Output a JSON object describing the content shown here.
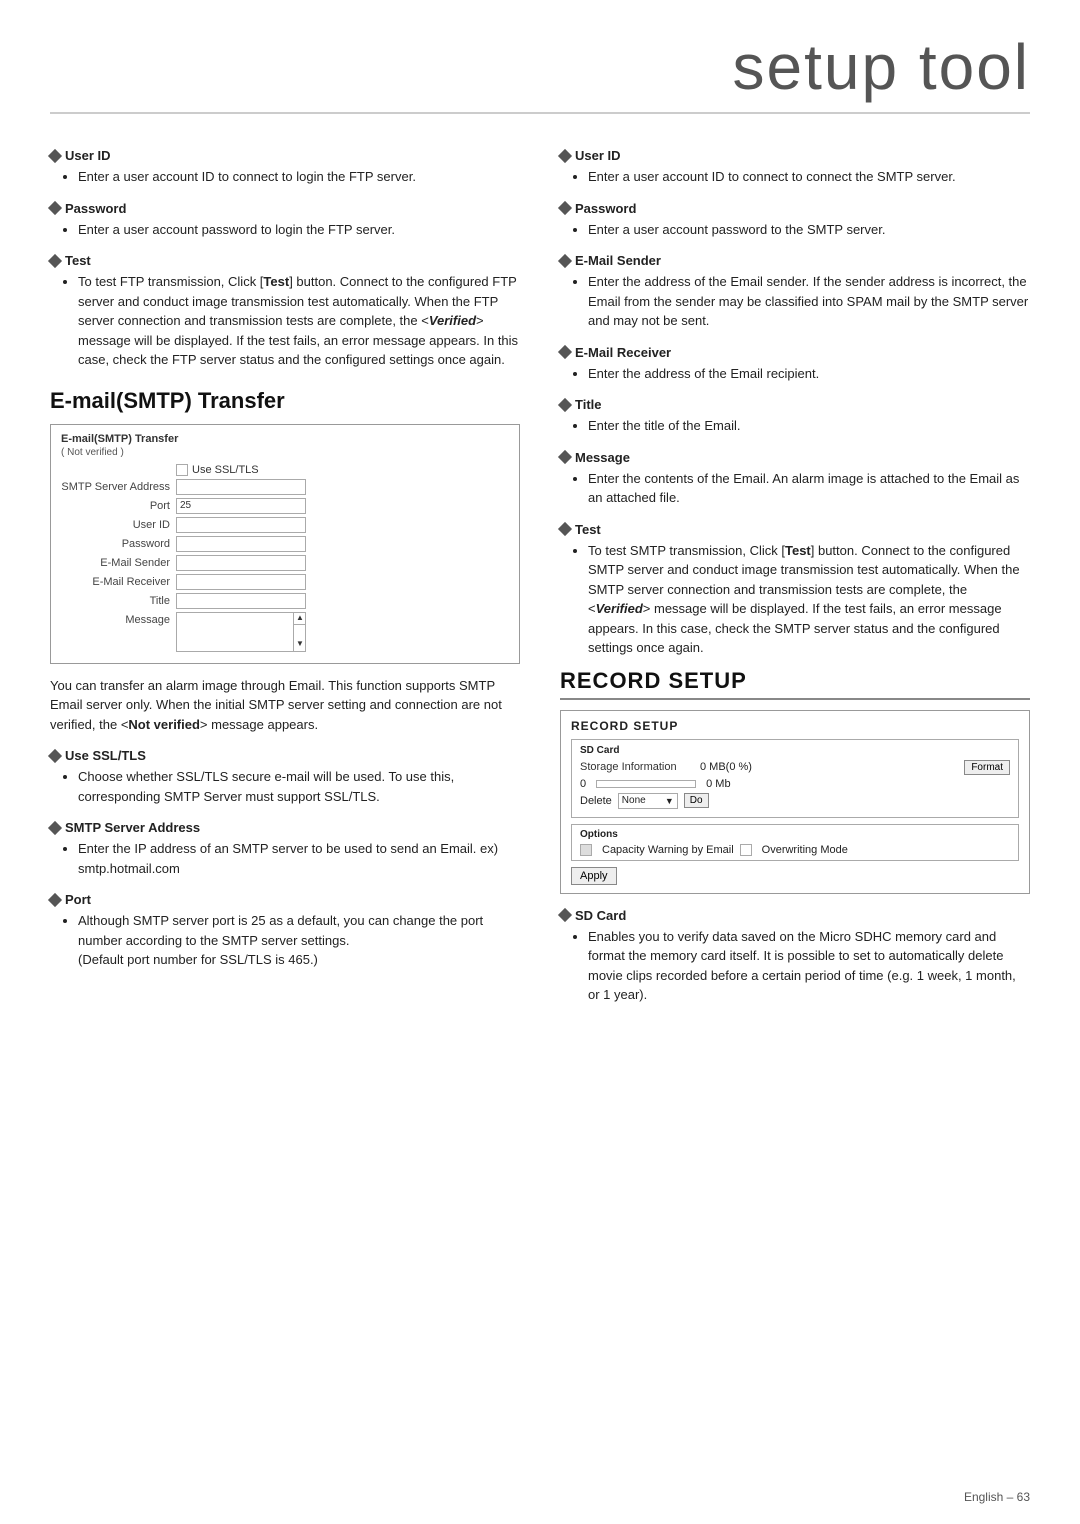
{
  "header": {
    "title": "setup tool"
  },
  "left_column": {
    "sections": [
      {
        "id": "left-user-id",
        "heading": "User ID",
        "bullets": [
          "Enter a user account ID to connect to login the FTP server."
        ]
      },
      {
        "id": "left-password",
        "heading": "Password",
        "bullets": [
          "Enter a user account password to login the FTP server."
        ]
      },
      {
        "id": "left-test",
        "heading": "Test",
        "bullets": [
          "To test FTP transmission, Click [Test] button. Connect to the configured FTP server and conduct image transmission test automatically. When the FTP server connection and transmission tests are complete, the <Verified> message will be displayed. If the test fails, an error message appears. In this case, check the FTP server status and the configured settings once again."
        ]
      }
    ],
    "email_smtp_section": {
      "title": "E-mail(SMTP) Transfer",
      "ui": {
        "title": "E-mail(SMTP) Transfer",
        "subtitle": "( Not verified )",
        "checkbox_label": "Use SSL/TLS",
        "fields": [
          {
            "label": "SMTP Server Address",
            "value": ""
          },
          {
            "label": "Port",
            "value": "25"
          },
          {
            "label": "User ID",
            "value": ""
          },
          {
            "label": "Password",
            "value": ""
          },
          {
            "label": "E-Mail Sender",
            "value": ""
          },
          {
            "label": "E-Mail Receiver",
            "value": ""
          },
          {
            "label": "Title",
            "value": ""
          }
        ],
        "message_label": "Message"
      }
    },
    "description": "You can transfer an alarm image through Email. This function supports SMTP Email server only. When the initial SMTP server setting and connection are not verified, the <Not verified> message appears.",
    "sub_sections": [
      {
        "id": "use-ssl-tls",
        "heading": "Use SSL/TLS",
        "bullets": [
          "Choose whether SSL/TLS secure e-mail will be used. To use this, corresponding SMTP Server must support SSL/TLS."
        ]
      },
      {
        "id": "smtp-server-address",
        "heading": "SMTP Server Address",
        "bullets": [
          "Enter the IP address of an SMTP server to be used to send an Email. ex) smtp.hotmail.com"
        ]
      },
      {
        "id": "port",
        "heading": "Port",
        "bullets": [
          "Although SMTP server port is 25 as a default, you can change the port number according to the SMTP server settings. (Default port number for SSL/TLS is 465.)"
        ]
      }
    ]
  },
  "right_column": {
    "sections": [
      {
        "id": "right-user-id",
        "heading": "User ID",
        "bullets": [
          "Enter a user account ID to connect to connect the SMTP server."
        ]
      },
      {
        "id": "right-password",
        "heading": "Password",
        "bullets": [
          "Enter a user account password to the SMTP server."
        ]
      },
      {
        "id": "email-sender",
        "heading": "E-Mail Sender",
        "bullets": [
          "Enter the address of the Email sender. If the sender address is incorrect, the Email from the sender may be classified into SPAM mail by the SMTP server and may not be sent."
        ]
      },
      {
        "id": "email-receiver",
        "heading": "E-Mail Receiver",
        "bullets": [
          "Enter the address of the Email recipient."
        ]
      },
      {
        "id": "title",
        "heading": "Title",
        "bullets": [
          "Enter the title of the Email."
        ]
      },
      {
        "id": "message",
        "heading": "Message",
        "bullets": [
          "Enter the contents of the Email. An alarm image is attached to the Email as an attached file."
        ]
      },
      {
        "id": "right-test",
        "heading": "Test",
        "bullets": [
          "To test SMTP transmission, Click [Test] button. Connect to the configured SMTP server and conduct image transmission test automatically. When the SMTP server connection and transmission tests are complete, the <Verified> message will be displayed. If the test fails, an error message appears. In this case, check the SMTP server status and the configured settings once again."
        ]
      }
    ],
    "record_setup": {
      "title": "RECORD SETUP",
      "ui": {
        "title": "RECORD SETUP",
        "sd_card_section": {
          "title": "SD Card",
          "storage_label": "Storage Information",
          "storage_value": "0 MB(0 %)",
          "format_btn": "Format",
          "progress_left": "0",
          "progress_right": "0 Mb",
          "delete_label": "Delete",
          "delete_option": "None",
          "do_btn": "Do"
        },
        "options_section": {
          "title": "Options",
          "checkbox1_label": "Capacity Warning by Email",
          "checkbox1_checked": true,
          "checkbox2_label": "Overwriting Mode",
          "checkbox2_checked": false
        },
        "apply_btn": "Apply"
      },
      "sd_card_section": {
        "heading": "SD Card",
        "bullets": [
          "Enables you to verify data saved on the Micro SDHC memory card and format the memory card itself. It is possible to set to automatically delete movie clips recorded before a certain period of time (e.g. 1 week, 1 month, or 1 year)."
        ]
      }
    }
  },
  "footer": {
    "text": "English – 63"
  }
}
